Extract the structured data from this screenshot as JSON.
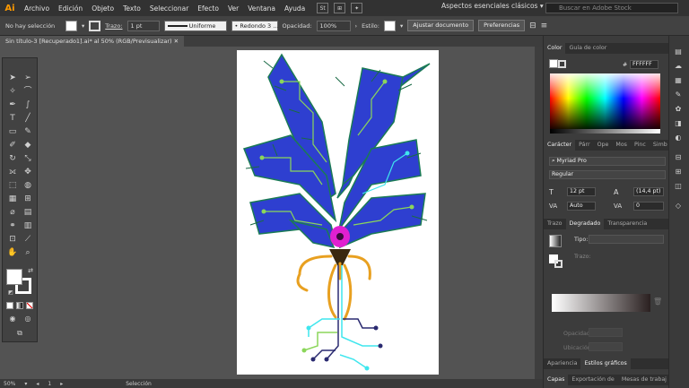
{
  "app": {
    "logo": "Ai",
    "menu": [
      "Archivo",
      "Edición",
      "Objeto",
      "Texto",
      "Seleccionar",
      "Efecto",
      "Ver",
      "Ventana",
      "Ayuda"
    ],
    "menu_icons": [
      "St",
      "⊞",
      "✦"
    ],
    "workspace": "Aspectos esenciales clásicos",
    "search_placeholder": "Buscar en Adobe Stock"
  },
  "control_bar": {
    "selection": "No hay selección",
    "stroke_label": "Trazo:",
    "stroke_value": "1 pt",
    "profile": "Uniforme",
    "brush": "Redondo 3 ...",
    "opacity_label": "Opacidad:",
    "opacity_value": "100%",
    "style_label": "Estilo:",
    "adjust_button": "Ajustar documento",
    "prefs_button": "Preferencias"
  },
  "document": {
    "tab_title": "Sin título-3 [Recuperado1].ai* al 50% (RGB/Previsualizar)",
    "zoom": "50%",
    "page": "1",
    "status": "Selección"
  },
  "color_panel": {
    "tabs": [
      "Color",
      "Guía de color"
    ],
    "hex": "FFFFFF"
  },
  "character_panel": {
    "tabs": [
      "Carácter",
      "Párr",
      "Ope",
      "Mos",
      "Pinc",
      "Simb"
    ],
    "font": "Myriad Pro",
    "style": "Regular",
    "size": "12 pt",
    "leading": "(14,4 pt)",
    "kerning": "Auto",
    "tracking": "0"
  },
  "gradient_panel": {
    "tabs": [
      "Trazo",
      "Degradado",
      "Transparencia"
    ],
    "type_label": "Tipo:",
    "stroke_label": "Trazo:",
    "opacity_label": "Opacidad:",
    "location_label": "Ubicación:"
  },
  "bottom_panels": {
    "row1": [
      "Apariencia",
      "Estilos gráficos"
    ],
    "row2": [
      "Capas",
      "Exportación de",
      "Mesas de trabaj"
    ]
  },
  "colors": {
    "menubar": "#323232",
    "panel": "#3c3c3c",
    "canvas": "#535353",
    "artboard": "#ffffff",
    "leaf": "#2a3cc8",
    "leaf_edge": "#1f8a5a",
    "circuit_green": "#8bd65a",
    "circuit_cyan": "#3fe6ee",
    "circuit_navy": "#2a2a70",
    "eye": "#e020d0",
    "tentacle": "#e8a020"
  }
}
